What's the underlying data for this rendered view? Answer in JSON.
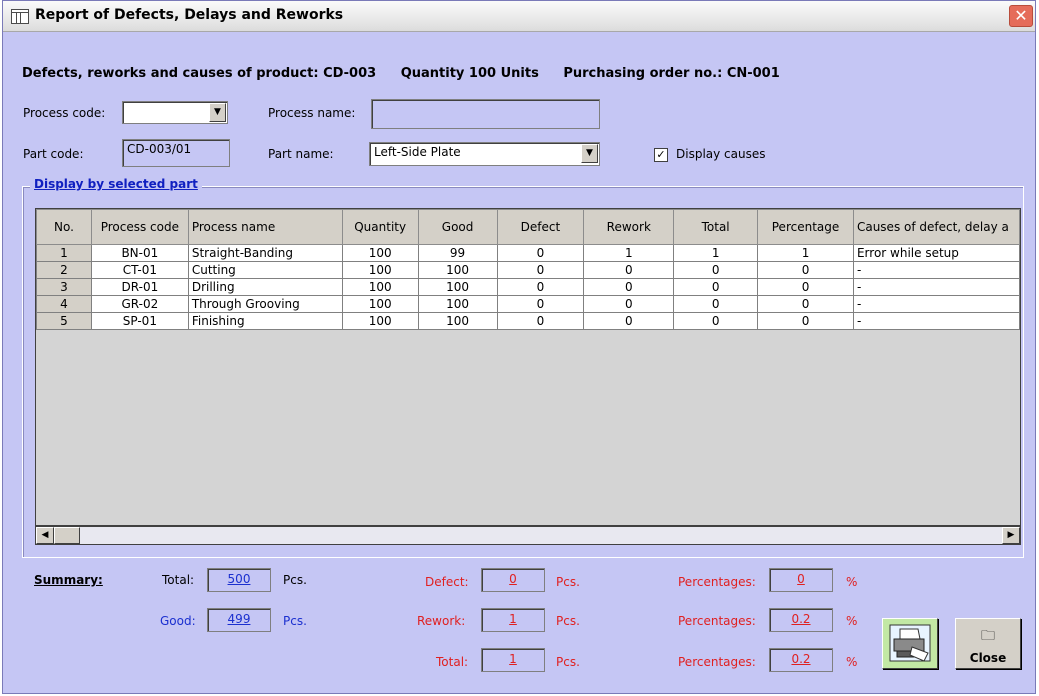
{
  "window": {
    "title": "Report of Defects, Delays and Reworks",
    "close_glyph": "✕"
  },
  "heading": {
    "product": "Defects, reworks and causes of product: CD-003",
    "quantity": "Quantity 100 Units",
    "order": "Purchasing order no.: CN-001"
  },
  "form": {
    "process_code_label": "Process code:",
    "process_code_value": "",
    "process_name_label": "Process name:",
    "process_name_value": "",
    "part_code_label": "Part code:",
    "part_code_value": "CD-003/01",
    "part_name_label": "Part name:",
    "part_name_value": "Left-Side Plate",
    "display_causes_label": "Display causes",
    "display_causes_checked": true
  },
  "group": {
    "title": "Display by selected part"
  },
  "table": {
    "columns": [
      "No.",
      "Process code",
      "Process name",
      "Quantity",
      "Good",
      "Defect",
      "Rework",
      "Total",
      "Percentage",
      "Causes of defect, delay a"
    ],
    "rows": [
      [
        "1",
        "BN-01",
        "Straight-Banding",
        "100",
        "99",
        "0",
        "1",
        "1",
        "1",
        "Error while setup"
      ],
      [
        "2",
        "CT-01",
        "Cutting",
        "100",
        "100",
        "0",
        "0",
        "0",
        "0",
        "-"
      ],
      [
        "3",
        "DR-01",
        "Drilling",
        "100",
        "100",
        "0",
        "0",
        "0",
        "0",
        "-"
      ],
      [
        "4",
        "GR-02",
        "Through Grooving",
        "100",
        "100",
        "0",
        "0",
        "0",
        "0",
        "-"
      ],
      [
        "5",
        "SP-01",
        "Finishing",
        "100",
        "100",
        "0",
        "0",
        "0",
        "0",
        "-"
      ]
    ]
  },
  "summary": {
    "label": "Summary:",
    "total_label": "Total:",
    "total_value": "500",
    "total_unit": "Pcs.",
    "good_label": "Good:",
    "good_value": "499",
    "good_unit": "Pcs.",
    "defect_label": "Defect:",
    "defect_value": "0",
    "defect_unit": "Pcs.",
    "rework_label": "Rework:",
    "rework_value": "1",
    "rework_unit": "Pcs.",
    "total2_label": "Total:",
    "total2_value": "1",
    "total2_unit": "Pcs.",
    "pct_label": "Percentages:",
    "pct1_value": "0",
    "pct2_value": "0.2",
    "pct3_value": "0.2",
    "pct_unit": "%"
  },
  "buttons": {
    "print_icon": "printer-icon",
    "close_label": "Close"
  }
}
